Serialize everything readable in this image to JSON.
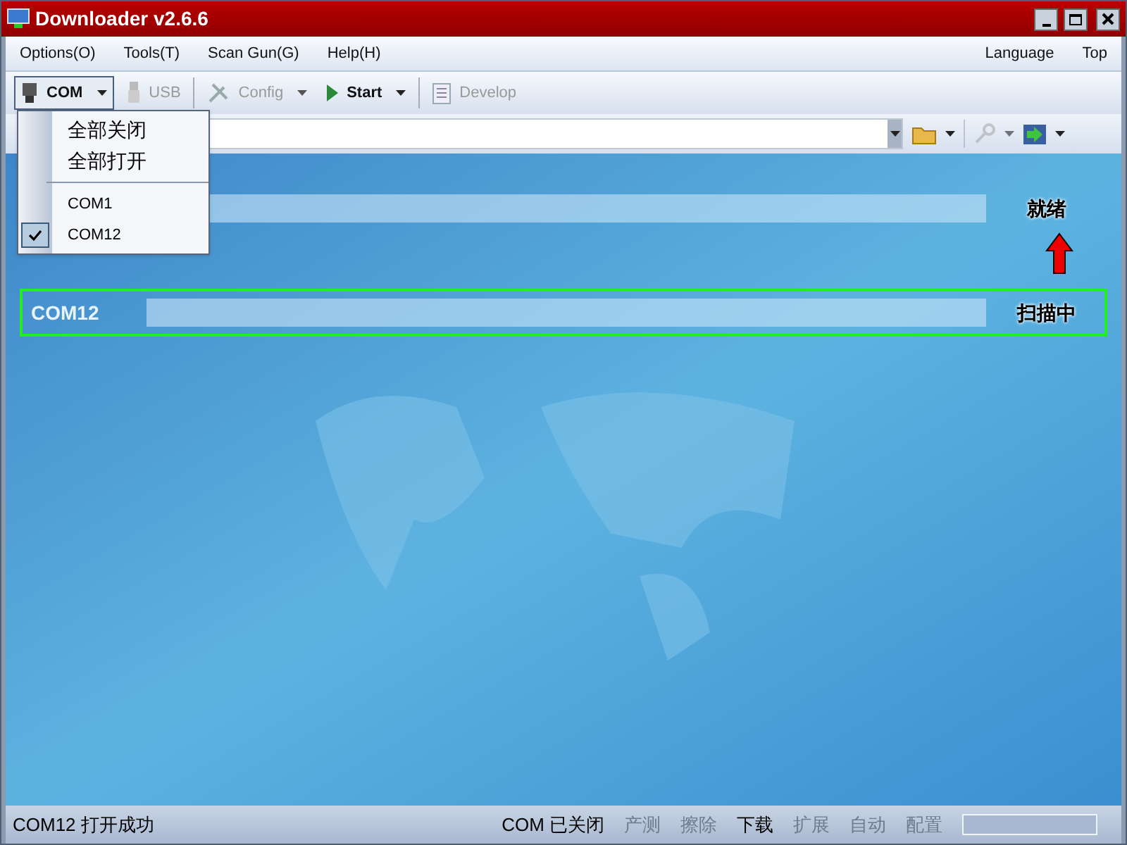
{
  "window": {
    "title": "Downloader v2.6.6"
  },
  "menu": {
    "left": [
      "Options(O)",
      "Tools(T)",
      "Scan Gun(G)",
      "Help(H)"
    ],
    "right": [
      "Language",
      "Top"
    ]
  },
  "toolbar": [
    {
      "kind": "dropdown",
      "label": "COM",
      "disabled": false,
      "pressed": true
    },
    {
      "kind": "button",
      "label": "USB",
      "disabled": true,
      "pressed": false
    },
    {
      "kind": "dropdown",
      "label": "Config",
      "disabled": true,
      "pressed": false
    },
    {
      "kind": "dropdown",
      "label": "Start",
      "disabled": false,
      "pressed": false
    },
    {
      "kind": "button",
      "label": "Develop",
      "disabled": true,
      "pressed": false
    }
  ],
  "toolbar2": {
    "tools": [
      {
        "disabled": false
      },
      {
        "disabled": true
      },
      {
        "disabled": false
      }
    ]
  },
  "dropdown_menu": {
    "items": [
      {
        "kind": "item",
        "label": "全部关闭",
        "checked": false
      },
      {
        "kind": "item",
        "label": "全部打开",
        "checked": false
      },
      {
        "kind": "separator"
      },
      {
        "kind": "port",
        "label": "COM1",
        "checked": false
      },
      {
        "kind": "port",
        "label": "COM12",
        "checked": true
      }
    ]
  },
  "channels": [
    {
      "level": 0,
      "status": "就绪",
      "highlighted": false,
      "arrow": true
    },
    {
      "label": "COM12",
      "level": 0,
      "status": "扫描中",
      "highlighted": true,
      "arrow": false
    }
  ],
  "status_bar": {
    "message": "COM12 打开成功",
    "port_state": "COM 已关闭",
    "modes": [
      {
        "label": "产测",
        "enabled": false
      },
      {
        "label": "擦除",
        "enabled": false
      },
      {
        "label": "下载",
        "enabled": true
      },
      {
        "label": "扩展",
        "enabled": false
      },
      {
        "label": "自动",
        "enabled": false
      },
      {
        "label": "配置",
        "enabled": false
      }
    ],
    "progress": {
      "level": 0
    }
  }
}
